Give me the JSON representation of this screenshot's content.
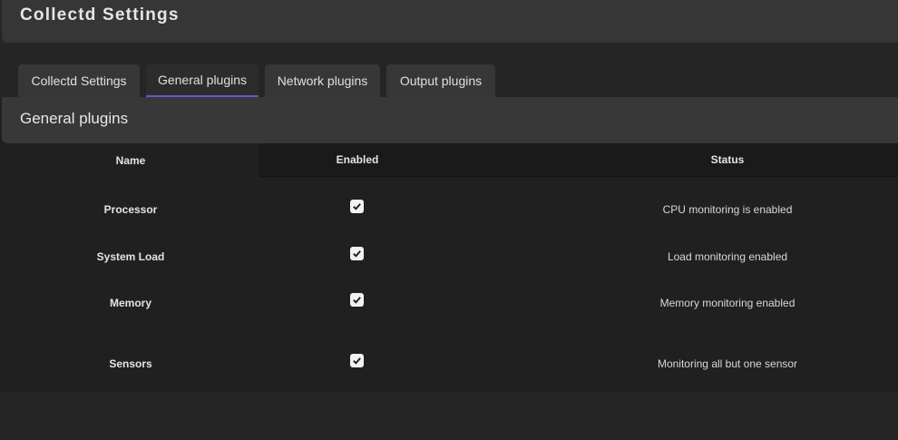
{
  "header": {
    "title": "Collectd Settings"
  },
  "tabs": [
    {
      "label": "Collectd Settings",
      "active": false
    },
    {
      "label": "General plugins",
      "active": true
    },
    {
      "label": "Network plugins",
      "active": false
    },
    {
      "label": "Output plugins",
      "active": false
    }
  ],
  "section": {
    "title": "General plugins",
    "columns": {
      "name": "Name",
      "enabled": "Enabled",
      "status": "Status"
    },
    "rows": [
      {
        "name": "Processor",
        "enabled": true,
        "status": "CPU monitoring is enabled"
      },
      {
        "name": "System Load",
        "enabled": true,
        "status": "Load monitoring enabled"
      },
      {
        "name": "Memory",
        "enabled": true,
        "status": "Memory monitoring enabled"
      },
      {
        "name": "Sensors",
        "enabled": true,
        "status": "Monitoring all but one sensor"
      }
    ]
  },
  "colors": {
    "accent": "#6b55c8",
    "background": "#252525",
    "panel": "#363636"
  }
}
